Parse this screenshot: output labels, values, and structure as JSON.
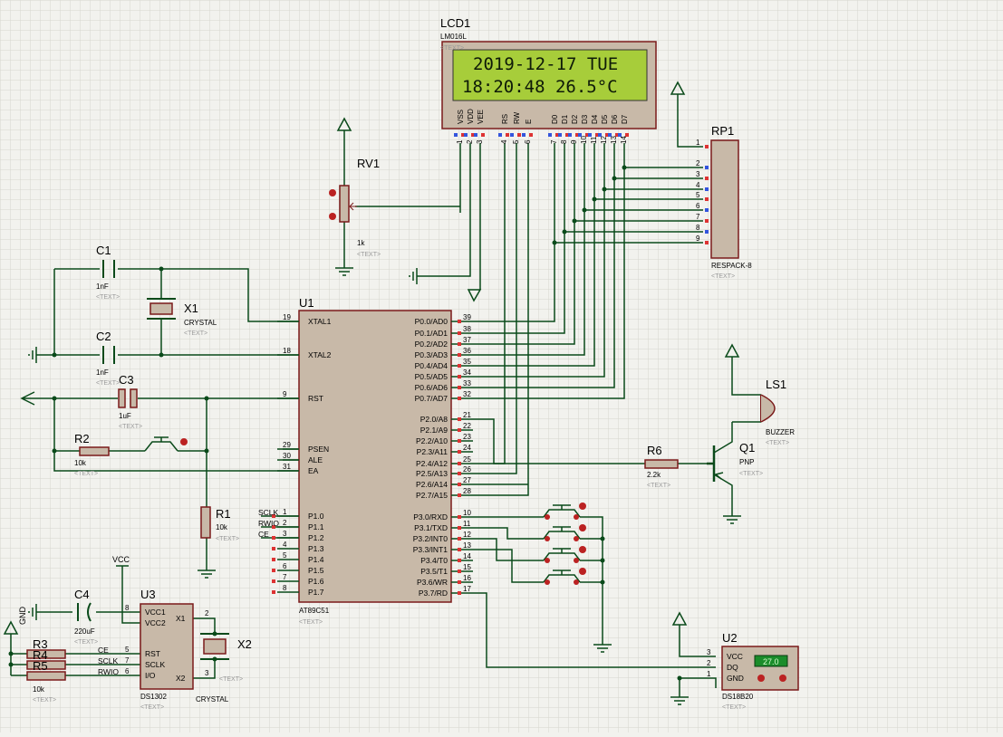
{
  "lcd": {
    "ref": "LCD1",
    "part": "LM016L",
    "line1": "2019-12-17 TUE",
    "line2": "18:20:48   26.5°C",
    "pins": [
      "VSS",
      "VDD",
      "VEE",
      "RS",
      "RW",
      "E",
      "D0",
      "D1",
      "D2",
      "D3",
      "D4",
      "D5",
      "D6",
      "D7"
    ],
    "pin_nums": [
      "1",
      "2",
      "3",
      "4",
      "5",
      "6",
      "7",
      "8",
      "9",
      "10",
      "11",
      "12",
      "13",
      "14"
    ]
  },
  "rp1": {
    "ref": "RP1",
    "part": "RESPACK-8",
    "pins": [
      "1",
      "2",
      "3",
      "4",
      "5",
      "6",
      "7",
      "8",
      "9"
    ]
  },
  "rv1": {
    "ref": "RV1",
    "value": "1k"
  },
  "c1": {
    "ref": "C1",
    "value": "1nF"
  },
  "c2": {
    "ref": "C2",
    "value": "1nF"
  },
  "c3": {
    "ref": "C3",
    "value": "1uF"
  },
  "c4": {
    "ref": "C4",
    "value": "220uF"
  },
  "x1": {
    "ref": "X1",
    "part": "CRYSTAL"
  },
  "x2": {
    "ref": "X2",
    "part": "CRYSTAL"
  },
  "r1": {
    "ref": "R1",
    "value": "10k"
  },
  "r2": {
    "ref": "R2",
    "value": "10k"
  },
  "r6": {
    "ref": "R6",
    "value": "2.2k"
  },
  "r3": {
    "ref": "R3"
  },
  "r4": {
    "ref": "R4"
  },
  "r5": {
    "ref": "R5",
    "value": "10k"
  },
  "q1": {
    "ref": "Q1",
    "part": "PNP"
  },
  "ls1": {
    "ref": "LS1",
    "part": "BUZZER"
  },
  "u1": {
    "ref": "U1",
    "part": "AT89C51",
    "left_pins": [
      {
        "name": "XTAL1",
        "num": "19"
      },
      {
        "name": "XTAL2",
        "num": "18"
      },
      {
        "name": "RST",
        "num": "9"
      },
      {
        "name": "PSEN",
        "num": "29"
      },
      {
        "name": "ALE",
        "num": "30"
      },
      {
        "name": "EA",
        "num": "31"
      },
      {
        "name": "P1.0",
        "num": "1"
      },
      {
        "name": "P1.1",
        "num": "2"
      },
      {
        "name": "P1.2",
        "num": "3"
      },
      {
        "name": "P1.3",
        "num": "4"
      },
      {
        "name": "P1.4",
        "num": "5"
      },
      {
        "name": "P1.5",
        "num": "6"
      },
      {
        "name": "P1.6",
        "num": "7"
      },
      {
        "name": "P1.7",
        "num": "8"
      }
    ],
    "right_pins": [
      {
        "name": "P0.0/AD0",
        "num": "39"
      },
      {
        "name": "P0.1/AD1",
        "num": "38"
      },
      {
        "name": "P0.2/AD2",
        "num": "37"
      },
      {
        "name": "P0.3/AD3",
        "num": "36"
      },
      {
        "name": "P0.4/AD4",
        "num": "35"
      },
      {
        "name": "P0.5/AD5",
        "num": "34"
      },
      {
        "name": "P0.6/AD6",
        "num": "33"
      },
      {
        "name": "P0.7/AD7",
        "num": "32"
      },
      {
        "name": "P2.0/A8",
        "num": "21"
      },
      {
        "name": "P2.1/A9",
        "num": "22"
      },
      {
        "name": "P2.2/A10",
        "num": "23"
      },
      {
        "name": "P2.3/A11",
        "num": "24"
      },
      {
        "name": "P2.4/A12",
        "num": "25"
      },
      {
        "name": "P2.5/A13",
        "num": "26"
      },
      {
        "name": "P2.6/A14",
        "num": "27"
      },
      {
        "name": "P2.7/A15",
        "num": "28"
      },
      {
        "name": "P3.0/RXD",
        "num": "10"
      },
      {
        "name": "P3.1/TXD",
        "num": "11"
      },
      {
        "name": "P3.2/INT0",
        "num": "12"
      },
      {
        "name": "P3.3/INT1",
        "num": "13"
      },
      {
        "name": "P3.4/T0",
        "num": "14"
      },
      {
        "name": "P3.5/T1",
        "num": "15"
      },
      {
        "name": "P3.6/WR",
        "num": "16"
      },
      {
        "name": "P3.7/RD",
        "num": "17"
      }
    ],
    "net_labels": [
      "SCLK",
      "RWIO",
      "CE"
    ]
  },
  "u2": {
    "ref": "U2",
    "part": "DS18B20",
    "reading": "27.0",
    "pins": [
      {
        "name": "VCC",
        "num": "3"
      },
      {
        "name": "DQ",
        "num": "2"
      },
      {
        "name": "GND",
        "num": "1"
      }
    ]
  },
  "u3": {
    "ref": "U3",
    "part": "DS1302",
    "pins_left": [
      {
        "name": "VCC1",
        "num": "8"
      },
      {
        "name": "VCC2",
        "num": ""
      },
      {
        "name": "RST",
        "num": "5"
      },
      {
        "name": "SCLK",
        "num": "7"
      },
      {
        "name": "I/O",
        "num": "6"
      }
    ],
    "pins_right": [
      {
        "name": "X1",
        "num": "2"
      },
      {
        "name": "X2",
        "num": "3"
      }
    ],
    "net_labels": [
      "CE",
      "SCLK",
      "RWIO"
    ]
  },
  "power": {
    "vcc": "VCC",
    "gnd": "GND"
  },
  "text_placeholder": "<TEXT>",
  "colors": {
    "wire": "#0a4a1a",
    "body": "#c8b9a8",
    "outline": "#7a1a1a",
    "lcd_bg": "#a7cd3a",
    "grid": "#d6d6cf"
  }
}
